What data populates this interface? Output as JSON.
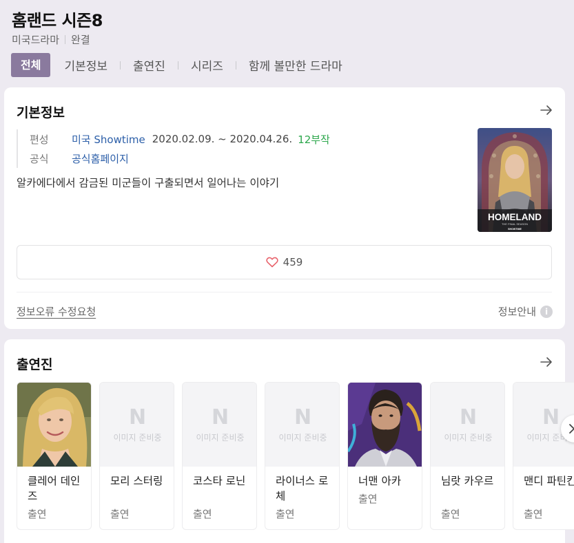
{
  "header": {
    "title": "홈랜드 시즌8",
    "genre": "미국드라마",
    "status": "완결"
  },
  "tabs": [
    {
      "label": "전체",
      "active": true
    },
    {
      "label": "기본정보"
    },
    {
      "label": "출연진"
    },
    {
      "label": "시리즈"
    },
    {
      "label": "함께 볼만한 드라마"
    }
  ],
  "basic_info": {
    "section_title": "기본정보",
    "broadcast_label": "편성",
    "broadcast_network": "미국 Showtime",
    "broadcast_period": "2020.02.09. ~ 2020.04.26.",
    "episodes": "12부작",
    "official_label": "공식",
    "official_link": "공식홈페이지",
    "synopsis": "알카에다에서 감금된 미군들이 구출되면서 일어나는 이야기",
    "poster": {
      "logo": "HOMELAND",
      "sub": "THE FINAL SEASON",
      "network": "SHOWTIME"
    },
    "likes": "459",
    "report_link": "정보오류 수정요청",
    "info_guide": "정보안내"
  },
  "cast": {
    "section_title": "출연진",
    "placeholder_mark": "N",
    "placeholder_text": "이미지 준비중",
    "members": [
      {
        "name": "클레어 데인즈",
        "role": "출연",
        "photo": "woman-blonde"
      },
      {
        "name": "모리 스터링",
        "role": "출연",
        "photo": "placeholder"
      },
      {
        "name": "코스타 로닌",
        "role": "출연",
        "photo": "placeholder"
      },
      {
        "name": "라이너스 로체",
        "role": "출연",
        "photo": "placeholder"
      },
      {
        "name": "너맨 아카",
        "role": "출연",
        "photo": "man-beard"
      },
      {
        "name": "님랏 카우르",
        "role": "출연",
        "photo": "placeholder"
      },
      {
        "name": "맨디 파틴킨",
        "role": "출연",
        "photo": "placeholder"
      }
    ]
  },
  "colors": {
    "tab_active_bg": "#8a7a9e",
    "link_blue": "#2b5ea8",
    "episode_green": "#2aa64a",
    "heart": "#e8626b"
  },
  "icons": {
    "arrow": "arrow-right-icon",
    "heart": "heart-icon",
    "info": "info-icon",
    "next": "chevron-right-icon"
  }
}
